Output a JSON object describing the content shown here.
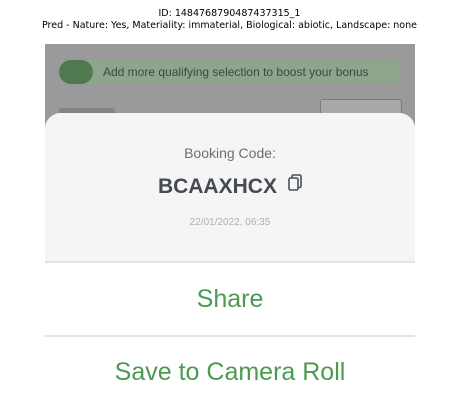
{
  "caption": {
    "id_line": "ID: 1484768790487437315_1",
    "pred_line": "Pred - Nature: Yes, Materiality: immaterial, Biological: abiotic, Landscape: none"
  },
  "background": {
    "banner_text": "Add more qualifying selection to boost your bonus",
    "banner_color": "#8da48d",
    "toggle_color": "#4f7a4f"
  },
  "sheet": {
    "booking_label": "Booking Code:",
    "booking_code": "BCAAXHCX",
    "copy_icon": "copy-icon",
    "timestamp": "22/01/2022, 06:35"
  },
  "actions": {
    "share_label": "Share",
    "save_label": "Save to Camera Roll",
    "accent_color": "#4c9a52"
  }
}
